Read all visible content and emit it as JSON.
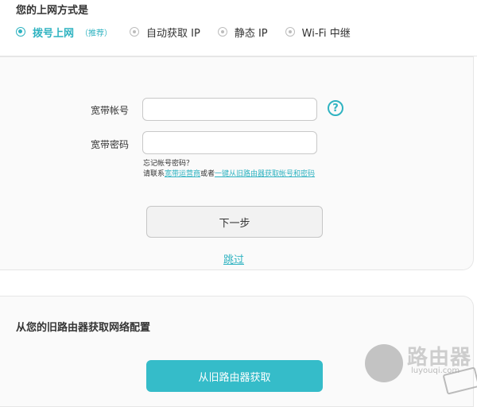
{
  "section_title": "您的上网方式是",
  "connection_options": [
    {
      "label": "拨号上网",
      "note": "（推荐）"
    },
    {
      "label": "自动获取 IP"
    },
    {
      "label": "静态 IP"
    },
    {
      "label": "Wi-Fi 中继"
    }
  ],
  "form": {
    "account_label": "宽带帐号",
    "account_value": "",
    "password_label": "宽带密码",
    "password_value": "",
    "help_glyph": "?",
    "help_icon": "question-circle-icon",
    "forgot_line": "忘记帐号密码？",
    "contact_prefix": "请联系",
    "isp_link": "宽带运营商",
    "or_text": "或者",
    "recover_link": "一键从旧路由器获取帐号和密码",
    "next_button": "下一步",
    "skip_link": "跳过"
  },
  "old_router": {
    "title": "从您的旧路由器获取网络配置",
    "button": "从旧路由器获取"
  },
  "watermark": {
    "text": "路由器",
    "url": "luyouqi.com"
  },
  "colors": {
    "accent": "#2fb3c1",
    "primary_button": "#35bcc9"
  }
}
